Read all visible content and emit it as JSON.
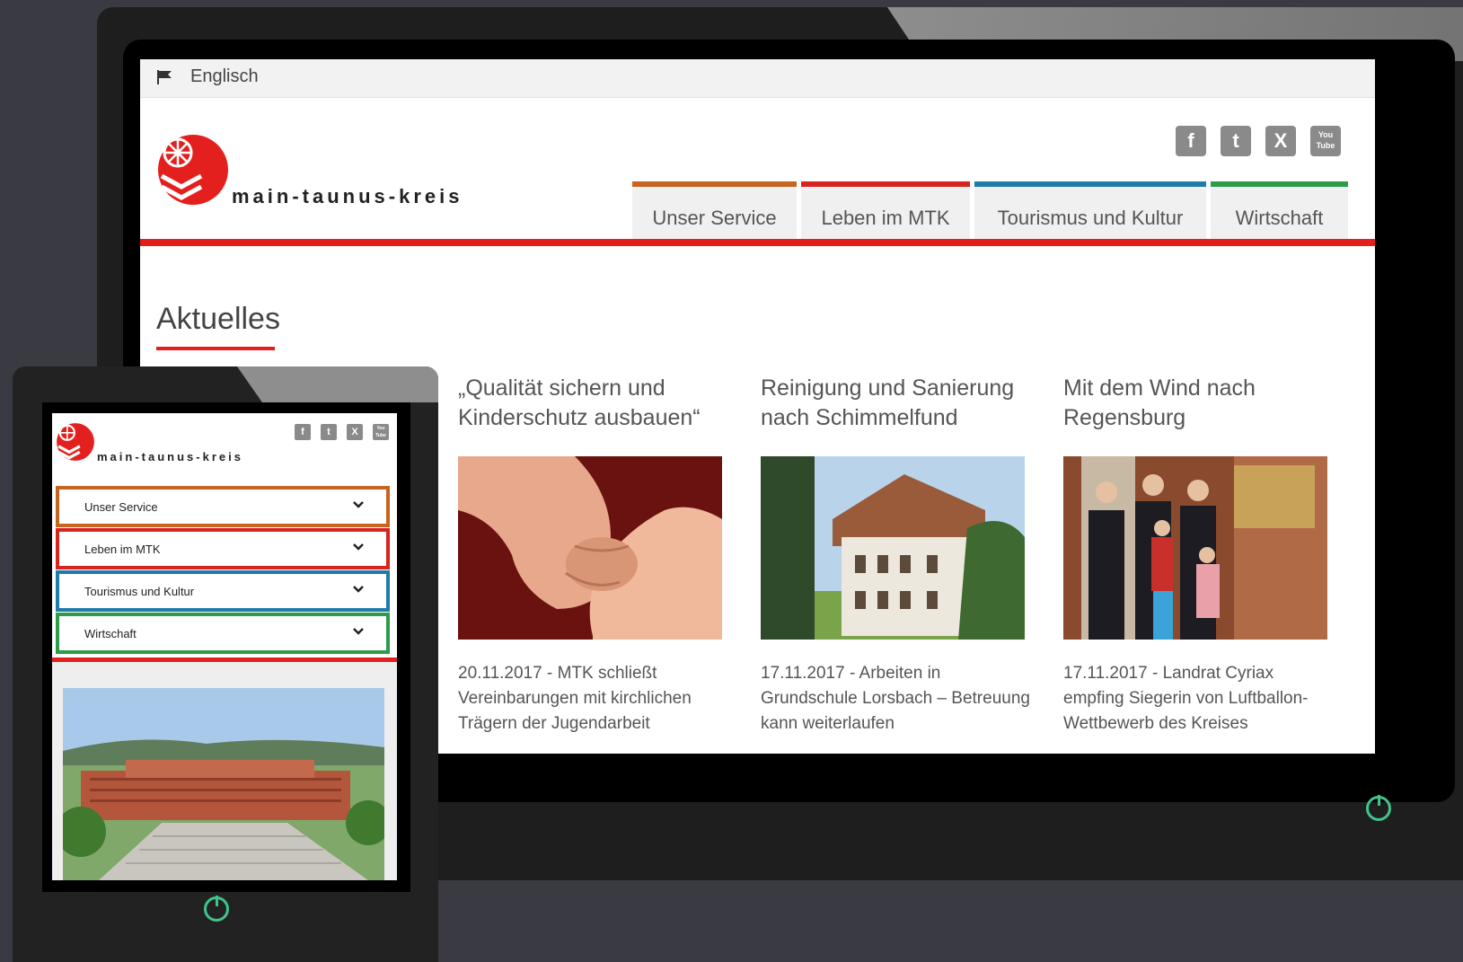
{
  "colors": {
    "brand_red": "#e4201e",
    "tab_service": "#c7641f",
    "tab_leben": "#d8231f",
    "tab_tourismus": "#1f7ba8",
    "tab_wirtschaft": "#2e9b4a",
    "power": "#3fc48a"
  },
  "desktop": {
    "topbar": {
      "language_link": "Englisch",
      "flag_icon": "flag-icon"
    },
    "brand": "main-taunus-kreis",
    "social": [
      {
        "icon": "facebook-icon",
        "glyph": "f"
      },
      {
        "icon": "twitter-icon",
        "glyph": "t"
      },
      {
        "icon": "xing-icon",
        "glyph": "X"
      },
      {
        "icon": "youtube-icon",
        "glyph": "You Tube"
      }
    ],
    "nav": [
      {
        "label": "Unser Service",
        "color": "#c7641f"
      },
      {
        "label": "Leben im MTK",
        "color": "#d8231f"
      },
      {
        "label": "Tourismus und Kultur",
        "color": "#1f7ba8"
      },
      {
        "label": "Wirtschaft",
        "color": "#2e9b4a"
      }
    ],
    "section_title": "Aktuelles",
    "news": [
      {
        "title": "„Qualität sichern und Kinderschutz ausbauen“",
        "text": "20.11.2017 - MTK schließt Vereinbarungen mit kirchlichen Trägern der Jugendarbeit"
      },
      {
        "title": "Reinigung und Sanierung nach Schimmelfund",
        "text": "17.11.2017 - Arbeiten in Grundschule Lorsbach – Betreuung kann weiterlaufen"
      },
      {
        "title": "Mit dem Wind nach Regensburg",
        "text": "17.11.2017 - Landrat Cyriax empfing Siegerin von Luftballon-Wettbewerb des Kreises"
      }
    ]
  },
  "tablet": {
    "brand": "main-taunus-kreis",
    "menu": [
      {
        "label": "Unser Service",
        "color": "#c7641f"
      },
      {
        "label": "Leben im MTK",
        "color": "#d8231f"
      },
      {
        "label": "Tourismus und Kultur",
        "color": "#1f7ba8"
      },
      {
        "label": "Wirtschaft",
        "color": "#2e9b4a"
      }
    ]
  }
}
